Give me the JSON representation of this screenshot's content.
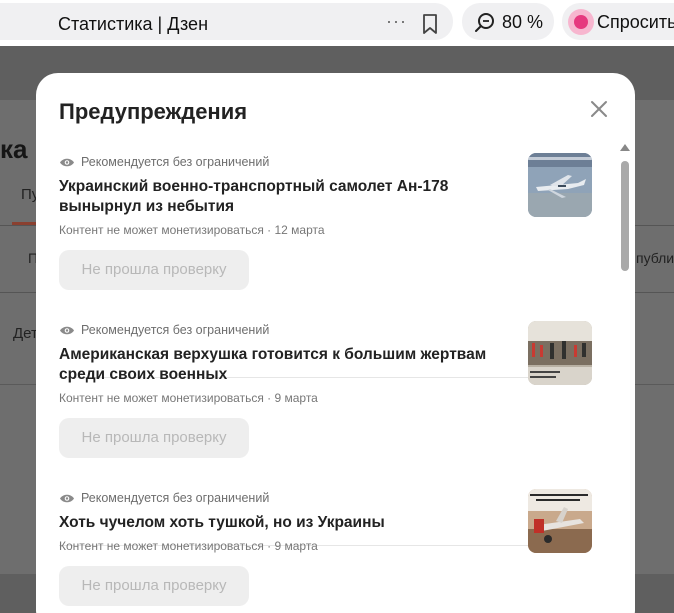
{
  "browser": {
    "tab_title": "Статистика | Дзен",
    "more_label": "···",
    "zoom": "80 %",
    "ask_label": "Спросить"
  },
  "background": {
    "heading": "ка к",
    "tab_label": "Пу",
    "col_p": "П",
    "col_publ": "публи",
    "row_label": "Дет"
  },
  "modal": {
    "title": "Предупреждения",
    "items": [
      {
        "status": "Рекомендуется без ограничений",
        "title": "Украинский военно-транспортный самолет Ан-178 вынырнул из небытия",
        "meta": "Контент не может монетизироваться · 12 марта",
        "button": "Не прошла проверку"
      },
      {
        "status": "Рекомендуется без ограничений",
        "title": "Американская верхушка готовится к большим жертвам среди своих военных",
        "meta": "Контент не может монетизироваться · 9 марта",
        "button": "Не прошла проверку"
      },
      {
        "status": "Рекомендуется без ограничений",
        "title": "Хоть чучелом хоть тушкой, но из Украины",
        "meta": "Контент не может монетизироваться · 9 марта",
        "button": "Не прошла проверку"
      }
    ]
  },
  "colors": {
    "overlay": "#616161",
    "modal_bg": "#ffffff",
    "disabled_button_bg": "#eeeeee",
    "disabled_button_text": "#b8b8b8",
    "accent_pink": "#e6397f"
  }
}
